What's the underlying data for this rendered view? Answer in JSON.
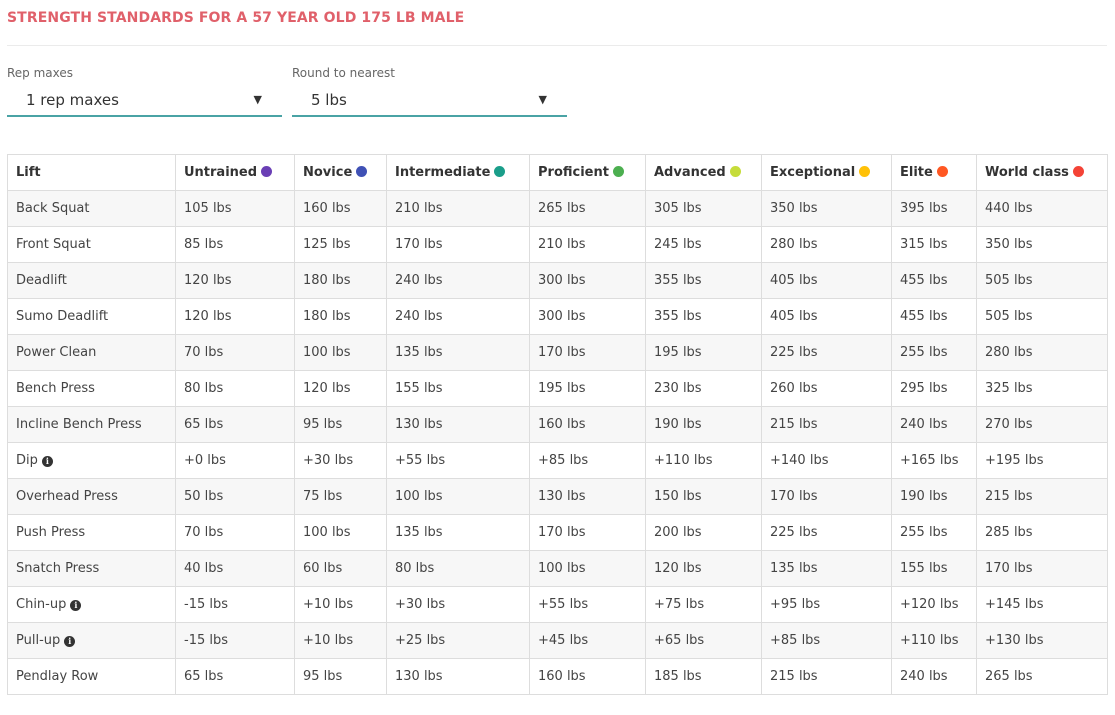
{
  "title": "STRENGTH STANDARDS FOR A 57 YEAR OLD 175 LB MALE",
  "filters": {
    "rep_maxes": {
      "label": "Rep maxes",
      "value": "1 rep maxes"
    },
    "round_to": {
      "label": "Round to nearest",
      "value": "5 lbs"
    }
  },
  "colors": {
    "title": "#e0606a",
    "select_underline": "#4aa3a5"
  },
  "table": {
    "columns": [
      {
        "label": "Lift",
        "color": null
      },
      {
        "label": "Untrained",
        "color": "#6a3fb5"
      },
      {
        "label": "Novice",
        "color": "#3f51b5"
      },
      {
        "label": "Intermediate",
        "color": "#1a9e8a"
      },
      {
        "label": "Proficient",
        "color": "#4caf50"
      },
      {
        "label": "Advanced",
        "color": "#c6dc3a"
      },
      {
        "label": "Exceptional",
        "color": "#ffc107"
      },
      {
        "label": "Elite",
        "color": "#ff5722"
      },
      {
        "label": "World class",
        "color": "#f44336"
      }
    ],
    "rows": [
      {
        "lift": "Back Squat",
        "info": false,
        "values": [
          "105 lbs",
          "160 lbs",
          "210 lbs",
          "265 lbs",
          "305 lbs",
          "350 lbs",
          "395 lbs",
          "440 lbs"
        ]
      },
      {
        "lift": "Front Squat",
        "info": false,
        "values": [
          "85 lbs",
          "125 lbs",
          "170 lbs",
          "210 lbs",
          "245 lbs",
          "280 lbs",
          "315 lbs",
          "350 lbs"
        ]
      },
      {
        "lift": "Deadlift",
        "info": false,
        "values": [
          "120 lbs",
          "180 lbs",
          "240 lbs",
          "300 lbs",
          "355 lbs",
          "405 lbs",
          "455 lbs",
          "505 lbs"
        ]
      },
      {
        "lift": "Sumo Deadlift",
        "info": false,
        "values": [
          "120 lbs",
          "180 lbs",
          "240 lbs",
          "300 lbs",
          "355 lbs",
          "405 lbs",
          "455 lbs",
          "505 lbs"
        ]
      },
      {
        "lift": "Power Clean",
        "info": false,
        "values": [
          "70 lbs",
          "100 lbs",
          "135 lbs",
          "170 lbs",
          "195 lbs",
          "225 lbs",
          "255 lbs",
          "280 lbs"
        ]
      },
      {
        "lift": "Bench Press",
        "info": false,
        "values": [
          "80 lbs",
          "120 lbs",
          "155 lbs",
          "195 lbs",
          "230 lbs",
          "260 lbs",
          "295 lbs",
          "325 lbs"
        ]
      },
      {
        "lift": "Incline Bench Press",
        "info": false,
        "values": [
          "65 lbs",
          "95 lbs",
          "130 lbs",
          "160 lbs",
          "190 lbs",
          "215 lbs",
          "240 lbs",
          "270 lbs"
        ]
      },
      {
        "lift": "Dip",
        "info": true,
        "values": [
          "+0 lbs",
          "+30 lbs",
          "+55 lbs",
          "+85 lbs",
          "+110 lbs",
          "+140 lbs",
          "+165 lbs",
          "+195 lbs"
        ]
      },
      {
        "lift": "Overhead Press",
        "info": false,
        "values": [
          "50 lbs",
          "75 lbs",
          "100 lbs",
          "130 lbs",
          "150 lbs",
          "170 lbs",
          "190 lbs",
          "215 lbs"
        ]
      },
      {
        "lift": "Push Press",
        "info": false,
        "values": [
          "70 lbs",
          "100 lbs",
          "135 lbs",
          "170 lbs",
          "200 lbs",
          "225 lbs",
          "255 lbs",
          "285 lbs"
        ]
      },
      {
        "lift": "Snatch Press",
        "info": false,
        "values": [
          "40 lbs",
          "60 lbs",
          "80 lbs",
          "100 lbs",
          "120 lbs",
          "135 lbs",
          "155 lbs",
          "170 lbs"
        ]
      },
      {
        "lift": "Chin-up",
        "info": true,
        "values": [
          "-15 lbs",
          "+10 lbs",
          "+30 lbs",
          "+55 lbs",
          "+75 lbs",
          "+95 lbs",
          "+120 lbs",
          "+145 lbs"
        ]
      },
      {
        "lift": "Pull-up",
        "info": true,
        "values": [
          "-15 lbs",
          "+10 lbs",
          "+25 lbs",
          "+45 lbs",
          "+65 lbs",
          "+85 lbs",
          "+110 lbs",
          "+130 lbs"
        ]
      },
      {
        "lift": "Pendlay Row",
        "info": false,
        "values": [
          "65 lbs",
          "95 lbs",
          "130 lbs",
          "160 lbs",
          "185 lbs",
          "215 lbs",
          "240 lbs",
          "265 lbs"
        ]
      }
    ]
  }
}
